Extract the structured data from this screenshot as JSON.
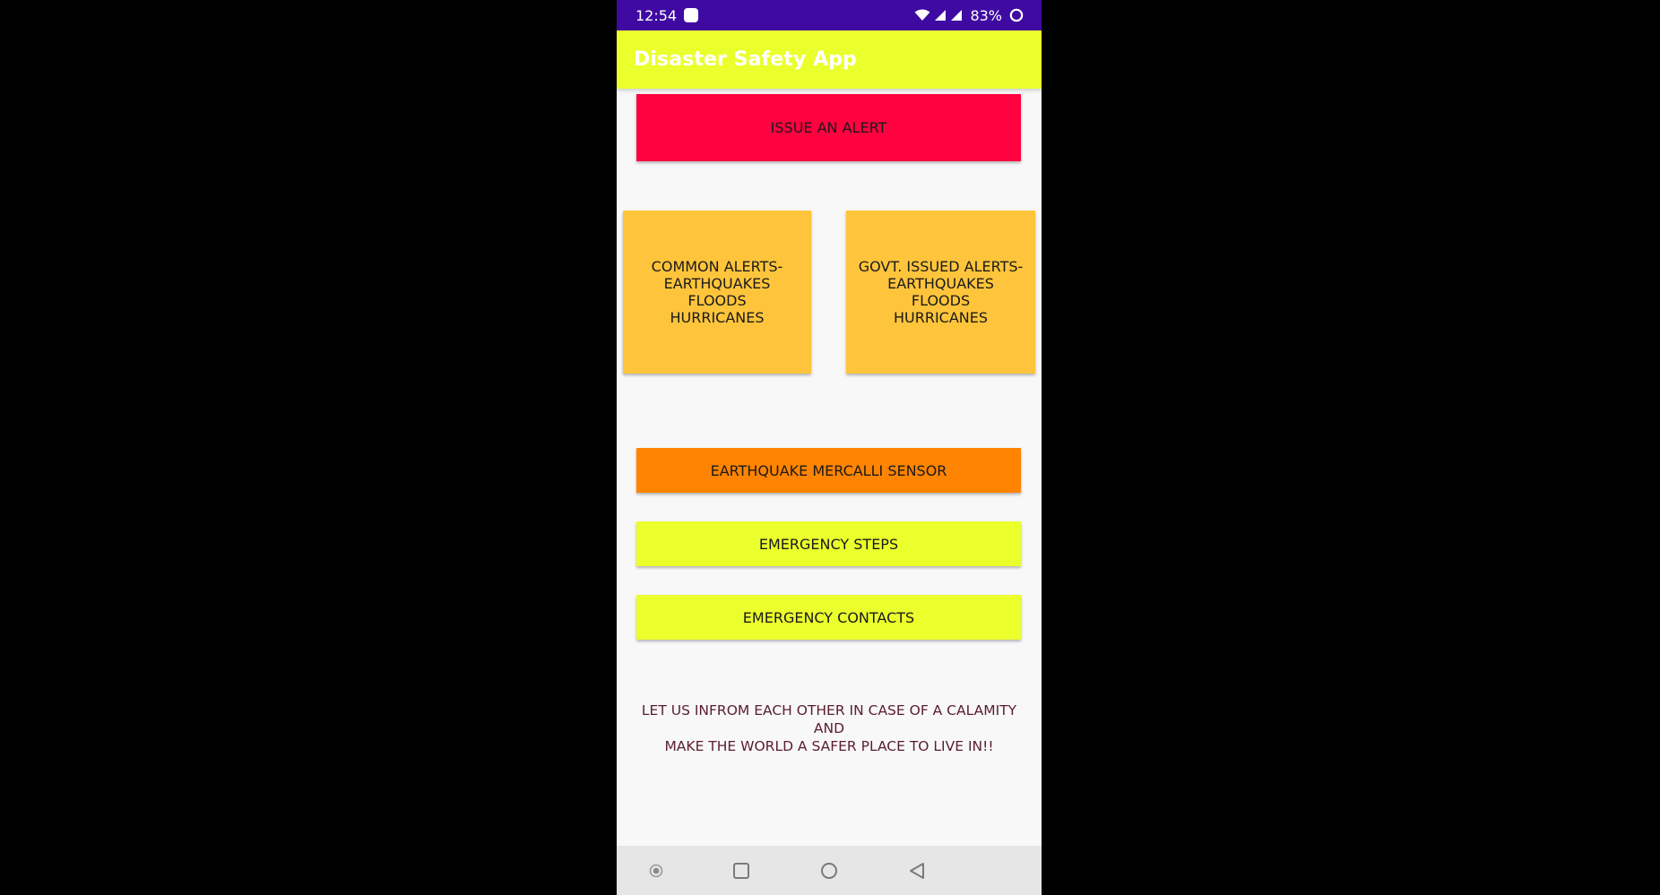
{
  "status_bar": {
    "time": "12:54",
    "battery_percent": "83%",
    "icons": [
      "notification-icon",
      "wifi-icon",
      "signal-icon",
      "signal-icon-2",
      "battery-icon"
    ]
  },
  "app_bar": {
    "title": "Disaster Safety App",
    "background": "#ebff2d"
  },
  "main": {
    "issue_alert_label": "ISSUE AN ALERT",
    "common_alerts_label": "COMMON ALERTS-\nEARTHQUAKES\nFLOODS\nHURRICANES",
    "govt_alerts_label": "GOVT. ISSUED ALERTS-\nEARTHQUAKES\nFLOODS\nHURRICANES",
    "mercalli_sensor_label": "EARTHQUAKE MERCALLI SENSOR",
    "emergency_steps_label": "EMERGENCY STEPS",
    "emergency_contacts_label": "EMERGENCY CONTACTS",
    "tagline": "LET US INFROM EACH OTHER IN CASE OF A CALAMITY AND\nMAKE THE WORLD A SAFER PLACE TO LIVE IN!!"
  },
  "colors": {
    "status_bar": "#3f0aa2",
    "alert_red": "#ff0240",
    "alerts_amber": "#fec43b",
    "sensor_orange": "#ff8402",
    "steps_yellow": "#ebff2d"
  },
  "nav_bar": {
    "icons": [
      "dot-icon",
      "recents-square-icon",
      "home-circle-icon",
      "back-triangle-icon"
    ]
  }
}
